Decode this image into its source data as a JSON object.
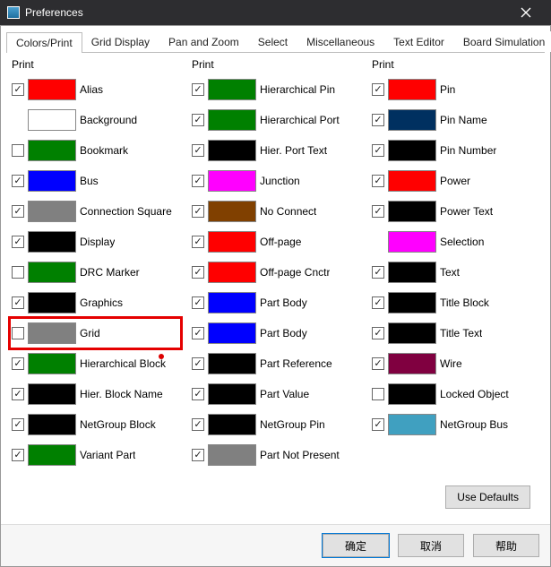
{
  "window": {
    "title": "Preferences"
  },
  "tabs": [
    {
      "label": "Colors/Print"
    },
    {
      "label": "Grid Display"
    },
    {
      "label": "Pan and Zoom"
    },
    {
      "label": "Select"
    },
    {
      "label": "Miscellaneous"
    },
    {
      "label": "Text Editor"
    },
    {
      "label": "Board Simulation"
    }
  ],
  "columns": [
    {
      "header": "Print",
      "items": [
        {
          "checked": true,
          "color": "#ff0000",
          "label": "Alias"
        },
        {
          "checked": null,
          "color": "#ffffff",
          "label": "Background"
        },
        {
          "checked": false,
          "color": "#008000",
          "label": "Bookmark"
        },
        {
          "checked": true,
          "color": "#0000ff",
          "label": "Bus"
        },
        {
          "checked": true,
          "color": "#808080",
          "label": "Connection Square"
        },
        {
          "checked": true,
          "color": "#000000",
          "label": "Display"
        },
        {
          "checked": false,
          "color": "#008000",
          "label": "DRC Marker"
        },
        {
          "checked": true,
          "color": "#000000",
          "label": "Graphics"
        },
        {
          "checked": false,
          "color": "#808080",
          "label": "Grid",
          "highlight": true
        },
        {
          "checked": true,
          "color": "#008000",
          "label": "Hierarchical Block"
        },
        {
          "checked": true,
          "color": "#000000",
          "label": "Hier. Block Name"
        },
        {
          "checked": true,
          "color": "#000000",
          "label": "NetGroup Block"
        },
        {
          "checked": true,
          "color": "#008000",
          "label": "Variant Part"
        }
      ]
    },
    {
      "header": "Print",
      "items": [
        {
          "checked": true,
          "color": "#008000",
          "label": "Hierarchical Pin"
        },
        {
          "checked": true,
          "color": "#008000",
          "label": "Hierarchical Port"
        },
        {
          "checked": true,
          "color": "#000000",
          "label": "Hier. Port Text"
        },
        {
          "checked": true,
          "color": "#ff00ff",
          "label": "Junction"
        },
        {
          "checked": true,
          "color": "#804000",
          "label": "No Connect"
        },
        {
          "checked": true,
          "color": "#ff0000",
          "label": "Off-page"
        },
        {
          "checked": true,
          "color": "#ff0000",
          "label": "Off-page Cnctr"
        },
        {
          "checked": true,
          "color": "#0000ff",
          "label": "Part Body"
        },
        {
          "checked": true,
          "color": "#0000ff",
          "label": "Part Body"
        },
        {
          "checked": true,
          "color": "#000000",
          "label": "Part Reference"
        },
        {
          "checked": true,
          "color": "#000000",
          "label": "Part Value"
        },
        {
          "checked": true,
          "color": "#000000",
          "label": "NetGroup Pin"
        },
        {
          "checked": true,
          "color": "#808080",
          "label": "Part Not Present"
        }
      ]
    },
    {
      "header": "Print",
      "items": [
        {
          "checked": true,
          "color": "#ff0000",
          "label": "Pin"
        },
        {
          "checked": true,
          "color": "#003060",
          "label": "Pin Name"
        },
        {
          "checked": true,
          "color": "#000000",
          "label": "Pin Number"
        },
        {
          "checked": true,
          "color": "#ff0000",
          "label": "Power"
        },
        {
          "checked": true,
          "color": "#000000",
          "label": "Power Text"
        },
        {
          "checked": null,
          "color": "#ff00ff",
          "label": "Selection"
        },
        {
          "checked": true,
          "color": "#000000",
          "label": "Text"
        },
        {
          "checked": true,
          "color": "#000000",
          "label": "Title Block"
        },
        {
          "checked": true,
          "color": "#000000",
          "label": "Title Text"
        },
        {
          "checked": true,
          "color": "#800040",
          "label": "Wire"
        },
        {
          "checked": false,
          "color": "#000000",
          "label": "Locked Object"
        },
        {
          "checked": true,
          "color": "#40a0c0",
          "label": "NetGroup Bus"
        }
      ]
    }
  ],
  "buttons": {
    "use_defaults": "Use Defaults",
    "ok": "确定",
    "cancel": "取消",
    "help": "帮助"
  }
}
